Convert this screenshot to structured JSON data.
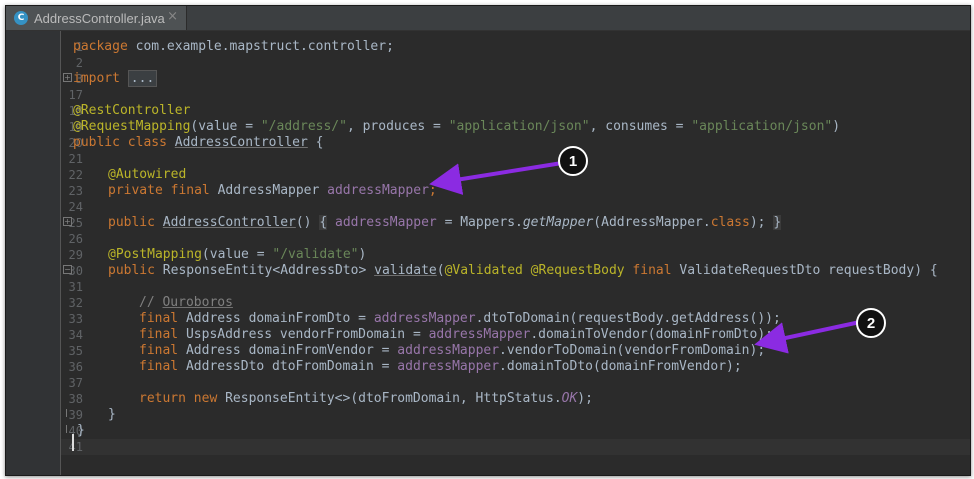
{
  "tab": {
    "title": "AddressController.java",
    "icon": "C",
    "close": "×"
  },
  "colors": {
    "keyword": "#cc7832",
    "annotation": "#bbb529",
    "string": "#6a8759",
    "field": "#9876aa",
    "arrow": "#8b2be2"
  },
  "lines": {
    "l1": {
      "num": "1",
      "kw": "package",
      "rest": " com.example.mapstruct.controller;"
    },
    "l2": {
      "num": "2"
    },
    "l3": {
      "num": "3",
      "kw": "import",
      "folded": "..."
    },
    "l17": {
      "num": "17"
    },
    "l18": {
      "num": "18",
      "ann": "@RestController"
    },
    "l19": {
      "num": "19",
      "ann": "@RequestMapping",
      "p1": "(value = ",
      "s1": "\"/address/\"",
      "p2": ", produces = ",
      "s2": "\"application/json\"",
      "p3": ", consumes = ",
      "s3": "\"application/json\"",
      "p4": ")"
    },
    "l20": {
      "num": "20",
      "kw": "public class ",
      "cls": "AddressController",
      "rest": " {"
    },
    "l21": {
      "num": "21"
    },
    "l22": {
      "num": "22",
      "ann": "@Autowired"
    },
    "l23": {
      "num": "23",
      "kw": "private final ",
      "type": "AddressMapper ",
      "fld": "addressMapper",
      "semi": ";"
    },
    "l24": {
      "num": "24"
    },
    "l25": {
      "num": "25",
      "kw": "public ",
      "ctor": "AddressController",
      "p1": "() ",
      "b1": "{",
      "fld": " addressMapper",
      "p2": " = Mappers.",
      "m": "getMapper",
      "p3": "(AddressMapper.",
      "kw2": "class",
      "p4": "); ",
      "b2": "}"
    },
    "l26": {
      "num": "26"
    },
    "l29": {
      "num": "29",
      "ann": "@PostMapping",
      "p1": "(value = ",
      "s1": "\"/validate\"",
      "p2": ")"
    },
    "l30": {
      "num": "30",
      "kw": "public ",
      "p1": "ResponseEntity<AddressDto> ",
      "m": "validate",
      "p2": "(",
      "a1": "@Validated ",
      "a2": "@RequestBody ",
      "kw2": "final ",
      "p3": "ValidateRequestDto requestBody) {"
    },
    "l31": {
      "num": "31"
    },
    "l32": {
      "num": "32",
      "cmt": "// ",
      "cmtw": "Ouroboros"
    },
    "l33": {
      "num": "33",
      "kw": "final ",
      "p1": "Address domainFromDto = ",
      "fld": "addressMapper",
      "p2": ".dtoToDomain(requestBody.getAddress());"
    },
    "l34": {
      "num": "34",
      "kw": "final ",
      "p1": "UspsAddress vendorFromDomain = ",
      "fld": "addressMapper",
      "p2": ".domainToVendor(domainFromDto);"
    },
    "l35": {
      "num": "35",
      "kw": "final ",
      "p1": "Address domainFromVendor = ",
      "fld": "addressMapper",
      "p2": ".vendorToDomain(vendorFromDomain);"
    },
    "l36": {
      "num": "36",
      "kw": "final ",
      "p1": "AddressDto dtoFromDomain = ",
      "fld": "addressMapper",
      "p2": ".domainToDto(domainFromVendor);"
    },
    "l37": {
      "num": "37"
    },
    "l38": {
      "num": "38",
      "kw": "return new ",
      "p1": "ResponseEntity<>(dtoFromDomain, HttpStatus.",
      "it": "OK",
      "p2": ");"
    },
    "l39": {
      "num": "39",
      "rest": "}"
    },
    "l40": {
      "num": "40",
      "rest": "}"
    },
    "l41": {
      "num": "41"
    }
  },
  "callouts": {
    "c1": "1",
    "c2": "2"
  }
}
